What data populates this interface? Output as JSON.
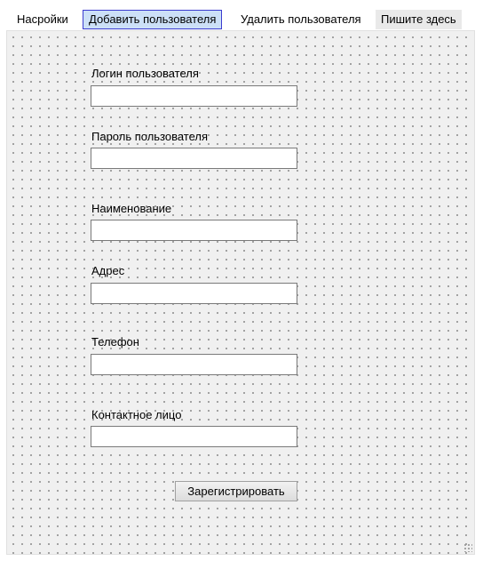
{
  "menubar": {
    "items": [
      {
        "label": "Насройки"
      },
      {
        "label": "Добавить пользователя",
        "active": true
      },
      {
        "label": "Удалить пользователя"
      },
      {
        "label": "Пишите здесь",
        "placeholder": true
      }
    ]
  },
  "form": {
    "fields": [
      {
        "label": "Логин пользователя",
        "value": ""
      },
      {
        "label": "Пароль пользователя",
        "value": ""
      },
      {
        "label": "Наименование",
        "value": ""
      },
      {
        "label": "Адрес",
        "value": ""
      },
      {
        "label": "Телефон",
        "value": ""
      },
      {
        "label": "Контактное лицо",
        "value": ""
      }
    ],
    "submit_label": "Зарегистрировать"
  },
  "colors": {
    "active_menu_bg": "#cce0f7",
    "active_menu_border": "#3c3ccf",
    "canvas_bg": "#f0f0f0",
    "grid_dot": "#8c8c8c"
  }
}
